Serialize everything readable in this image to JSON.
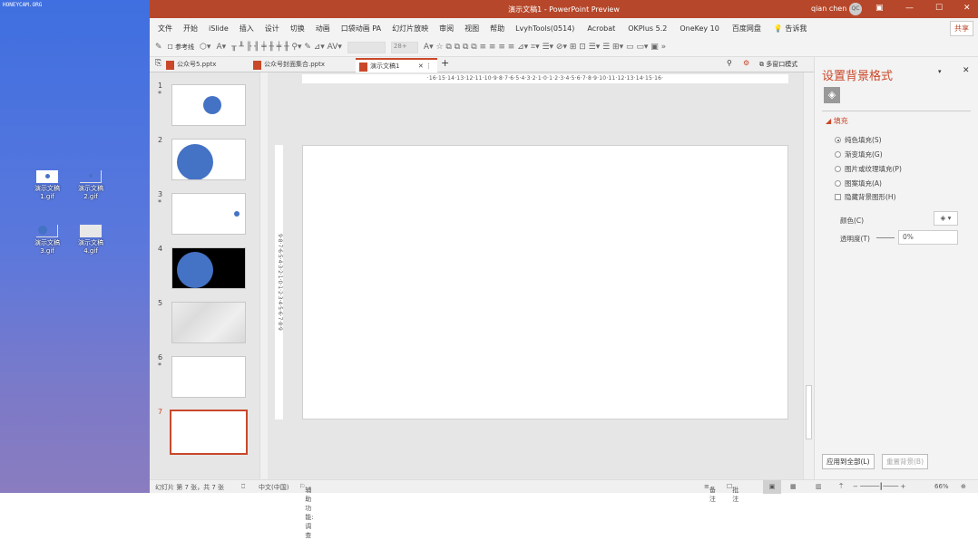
{
  "desktop": {
    "watermark": "HONEYCAM.ORG",
    "icons": [
      {
        "label": "演示文稿\n1.gif"
      },
      {
        "label": "演示文稿\n2.gif"
      },
      {
        "label": "演示文稿\n3.gif"
      },
      {
        "label": "演示文稿\n4.gif"
      }
    ]
  },
  "title": {
    "text": "演示文稿1  -  PowerPoint Preview",
    "user": "qian chen",
    "avatar": "QC",
    "accent": "#b7472a"
  },
  "menu": [
    "文件",
    "开始",
    "iSlide",
    "插入",
    "设计",
    "切换",
    "动画",
    "口袋动画 PA",
    "幻灯片放映",
    "审阅",
    "视图",
    "帮助",
    "LvyhTools(0514)",
    "Acrobat",
    "OKPlus 5.2",
    "OneKey 10",
    "百度网盘",
    "💡 告诉我"
  ],
  "share": "共享",
  "toolbar": {
    "guides": "参考线",
    "font_size": "28+"
  },
  "tabs": [
    {
      "label": "公众号5.pptx"
    },
    {
      "label": "公众号封面集合.pptx"
    },
    {
      "label": "演示文稿1"
    }
  ],
  "tabs_right": "多窗口模式",
  "slides": [
    {
      "num": "1",
      "star": "*"
    },
    {
      "num": "2",
      "star": ""
    },
    {
      "num": "3",
      "star": "*"
    },
    {
      "num": "4",
      "star": ""
    },
    {
      "num": "5",
      "star": ""
    },
    {
      "num": "6",
      "star": "*"
    },
    {
      "num": "7",
      "star": ""
    }
  ],
  "ruler_h": "·16·15·14·13·12·11·10·9·8·7·6·5·4·3·2·1·0·1·2·3·4·5·6·7·8·9·10·11·12·13·14·15·16·",
  "ruler_v": "9·8·7·6·5·4·3·2·1·0·1·2·3·4·5·6·7·8·9",
  "panel": {
    "title": "设置背景格式",
    "section": "填充",
    "options": [
      "纯色填充(S)",
      "渐变填充(G)",
      "图片或纹理填充(P)",
      "图案填充(A)"
    ],
    "selected_option": 0,
    "hide_bg": "隐藏背景图形(H)",
    "color_label": "颜色(C)",
    "transparency_label": "透明度(T)",
    "transparency_value": "0%",
    "apply_all": "应用到全部(L)",
    "reset": "重置背景(B)"
  },
  "status": {
    "slide": "幻灯片 第 7 张，共 7 张",
    "lang": "中文(中国)",
    "access": "辅助功能: 调查",
    "notes": "备注",
    "comments": "批注",
    "zoom": "66%",
    "zoom_value": 66
  }
}
